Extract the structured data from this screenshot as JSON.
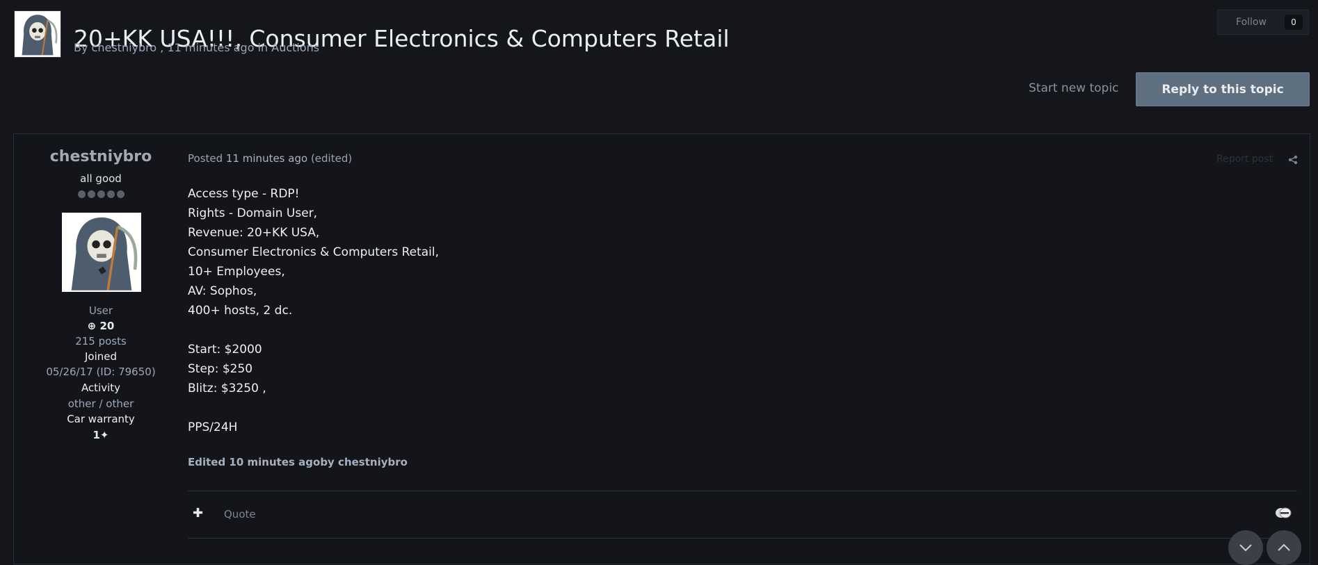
{
  "topic": {
    "title": "20+KK USA!!!, Consumer Electronics & Computers Retail",
    "by_label": "By",
    "author": "chestniybro",
    "time_text": ", 11 minutes ago in",
    "forum": "Auctions"
  },
  "follow": {
    "label": "Follow",
    "count": "0"
  },
  "actions": {
    "start_new_topic": "Start new topic",
    "reply": "Reply to this topic"
  },
  "author": {
    "name": "chestniybro",
    "title": "all good",
    "group": "User",
    "reputation": "20",
    "posts": "215 posts",
    "joined_label": "Joined",
    "joined_value": "05/26/17 (ID: 79650)",
    "activity_label": "Activity",
    "activity_value": "other / other",
    "warranty_label": "Car warranty",
    "warranty_value": "1"
  },
  "post": {
    "posted_label": "Posted",
    "posted_time": "11 minutes ago",
    "edited_tag": "(edited)",
    "report": "Report post",
    "lines": [
      "Access type - RDP!",
      "Rights - Domain User,",
      "Revenue: 20+KK USA,",
      "Consumer Electronics & Computers Retail,",
      "10+ Employees,",
      "AV: Sophos,",
      "400+ hosts, 2 dc.",
      "",
      "Start: $2000",
      "Step: $250",
      "Blitz: $3250 ,",
      "",
      "PPS/24H"
    ],
    "edited_note": "Edited 10 minutes agoby chestniybro",
    "quote": "Quote"
  },
  "icons": {
    "plus": "plus-icon",
    "share": "share-icon",
    "reaction": "reaction-icon",
    "scroll_down": "chevron-down-icon",
    "scroll_up": "chevron-up-icon",
    "reputation": "plus-circle-icon",
    "handshake": "handshake-icon"
  }
}
